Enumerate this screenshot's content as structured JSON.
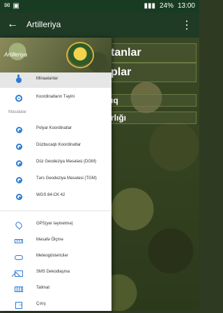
{
  "status_bar": {
    "time": "13:00",
    "battery": "24%"
  },
  "toolbar": {
    "title": "Artilleriya"
  },
  "background": {
    "buttons": [
      "tanlar",
      "plar",
      "ıq",
      "rlığı"
    ]
  },
  "drawer": {
    "app_name": "Artilleriya",
    "top_items": [
      {
        "label": "Minaatanlar",
        "icon": "bomb-icon"
      },
      {
        "label": "Koordinatların Təyini",
        "icon": "target-icon"
      }
    ],
    "section_title": "Masalalar",
    "section_items": [
      {
        "label": "Polyar Koordinatlar"
      },
      {
        "label": "Düzbucaqlı Koordinatlar"
      },
      {
        "label": "Düz Geodeziya Məsələsi (DGM)"
      },
      {
        "label": "Tərs Geodeziya Məsələsi (TGM)"
      },
      {
        "label": "WGS 84-CK 42"
      }
    ],
    "bottom_items": [
      {
        "label": "GPS(yer təyinetmə)",
        "icon": "gps-icon"
      },
      {
        "label": "Məsafə Ölçmə",
        "icon": "ruler-icon"
      },
      {
        "label": "Meteogöstəricilər",
        "icon": "cloud-icon"
      },
      {
        "label": "SMS Dekodlaşma",
        "icon": "mail-icon"
      },
      {
        "label": "Talimat",
        "icon": "keyboard-icon"
      },
      {
        "label": "Çıxış",
        "icon": "exit-icon"
      }
    ]
  },
  "colors": {
    "accent": "#2b7bd6",
    "toolbar": "#1f3b25"
  }
}
